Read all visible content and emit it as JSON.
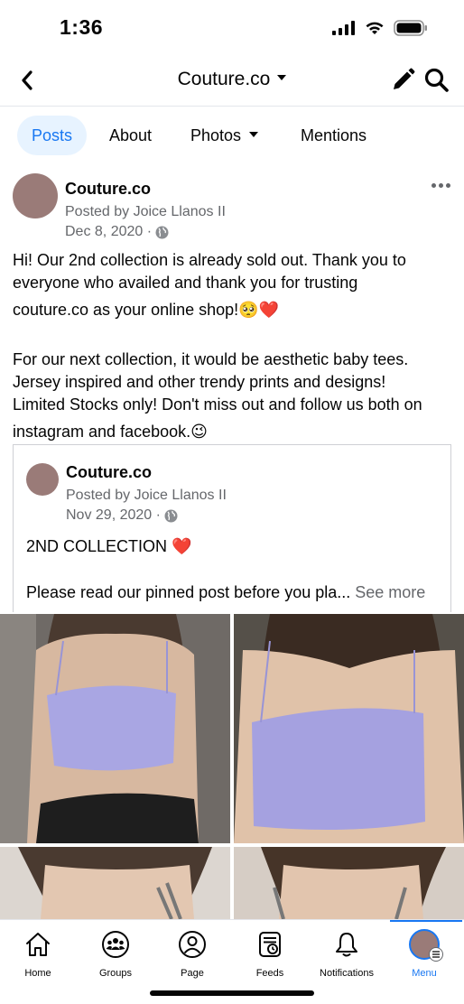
{
  "status_bar": {
    "time": "1:36"
  },
  "nav": {
    "title": "Couture.co"
  },
  "tabs": [
    {
      "label": "Posts"
    },
    {
      "label": "About"
    },
    {
      "label": "Photos"
    },
    {
      "label": "Mentions"
    }
  ],
  "post": {
    "author": "Couture.co",
    "posted_by": "Posted by Joice Llanos II",
    "date": "Dec 8, 2020 ·",
    "text_lines": [
      "Hi! Our 2nd collection is already sold out. Thank you to",
      "everyone who availed and thank you for trusting",
      "couture.co as your online shop!🥺❤️",
      "For our next collection, it would be aesthetic baby tees.",
      "Jersey inspired and other trendy prints and designs!",
      "Limited Stocks only! Don't miss out and follow us both on",
      "instagram and facebook.😉"
    ]
  },
  "shared": {
    "author": "Couture.co",
    "posted_by": "Posted by Joice Llanos II",
    "date": "Nov 29, 2020 ·",
    "line1": "2ND COLLECTION ❤️",
    "line2": "Please read our pinned post before you pla...",
    "see_more": "See more"
  },
  "bottom_nav": [
    {
      "label": "Home",
      "icon": "home-icon"
    },
    {
      "label": "Groups",
      "icon": "groups-icon"
    },
    {
      "label": "Page",
      "icon": "page-icon"
    },
    {
      "label": "Feeds",
      "icon": "feeds-icon"
    },
    {
      "label": "Notifications",
      "icon": "bell-icon"
    },
    {
      "label": "Menu",
      "icon": "menu-avatar-icon"
    }
  ],
  "colors": {
    "accent": "#1877f2",
    "tab_active_bg": "#e7f3ff",
    "secondary_text": "#65676b",
    "avatar": "#9a7b78",
    "top_color": "#a5a3e0"
  }
}
